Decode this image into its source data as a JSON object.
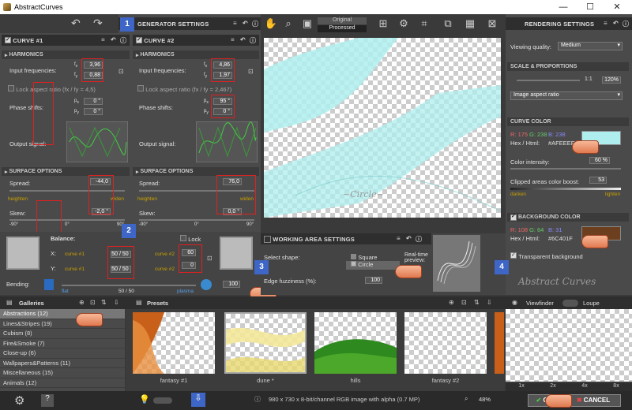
{
  "window": {
    "title": "AbstractCurves",
    "min": "—",
    "max": "☐",
    "close": "✕"
  },
  "generator": {
    "title": "GENERATOR SETTINGS",
    "num": "1"
  },
  "curve1": {
    "title": "CURVE #1",
    "harmonics": "HARMONICS",
    "input_freq": "Input frequencies:",
    "fx": "3,96",
    "fy": "0,88",
    "lock": "Lock aspect ratio (fx / fy = 4,5)",
    "phase": "Phase shifts:",
    "px": "0 °",
    "py": "0 °",
    "output": "Output signal:",
    "surface": "SURFACE OPTIONS",
    "spread_lbl": "Spread:",
    "spread": "-44,0",
    "heighten": "heighten",
    "widen": "widen",
    "skew_lbl": "Skew:",
    "skew": "-2,0 °",
    "m90": "-90°",
    "z0": "0°",
    "p90": "90°"
  },
  "curve2": {
    "title": "CURVE #2",
    "harmonics": "HARMONICS",
    "input_freq": "Input frequencies:",
    "fx": "4,86",
    "fy": "1,97",
    "lock": "Lock aspect ratio (fx / fy = 2,467)",
    "phase": "Phase shifts:",
    "px": "95 °",
    "py": "0 °",
    "output": "Output signal:",
    "surface": "SURFACE OPTIONS",
    "spread_lbl": "Spread:",
    "spread": "76,0",
    "heighten": "heighten",
    "widen": "widen",
    "skew_lbl": "Skew:",
    "skew": "0,0 °",
    "m90": "-90°",
    "z0": "0°",
    "p90": "90°"
  },
  "balance": {
    "label": "Balance:",
    "lock": "Lock",
    "x": "X:",
    "y": "Y:",
    "curve1": "curve #1",
    "curve2": "curve #2",
    "xval": "50 / 50",
    "yval": "50 / 50",
    "cx": "60",
    "cy": "0",
    "num": "2"
  },
  "bending": {
    "label": "Bending:",
    "flat": "flat",
    "plasma": "plasma",
    "val": "50 / 50",
    "fuzz": "100"
  },
  "toolbar": {
    "original": "Original",
    "processed": "Processed"
  },
  "working": {
    "title": "WORKING AREA SETTINGS",
    "shape": "Select shape:",
    "square": "Square",
    "circle": "Circle",
    "fuzz_lbl": "Edge fuzziness (%):",
    "fuzz": "100",
    "preview": "Real-time preview:",
    "num": "3"
  },
  "rendering": {
    "title": "RENDERING SETTINGS",
    "quality_lbl": "Viewing quality:",
    "quality": "Medium",
    "scale": "SCALE & PROPORTIONS",
    "ratio": "1:1",
    "pct": "120%",
    "aspect": "Image aspect ratio",
    "color": "CURVE COLOR",
    "r": "R: 175",
    "g": "G: 238",
    "b": "B: 238",
    "hex_lbl": "Hex / Html:",
    "hex": "#AFEEEE",
    "intensity_lbl": "Color intensity:",
    "intensity": "60 %",
    "clip_lbl": "Clipped areas color boost:",
    "clip": "53",
    "darken": "darken",
    "lighten": "lighten",
    "bg": "BACKGROUND COLOR",
    "br": "R: 108",
    "bgc": "G: 64",
    "bb": "B: 31",
    "bhex": "#6C401F",
    "transparent": "Transparent background",
    "logo": "Abstract Curves",
    "num": "4",
    "curve_color": "#AFEEEE",
    "bg_color": "#6C401F"
  },
  "galleries": {
    "title": "Galleries",
    "items": [
      "Abstractions (12)",
      "Lines&Stripes (19)",
      "Cubism (8)",
      "Fire&Smoke (7)",
      "Close-up (6)",
      "Wallpapers&Patterns (11)",
      "Miscellaneous (15)",
      "Animals (12)"
    ]
  },
  "presets": {
    "title": "Presets",
    "items": [
      "fantasy #1",
      "dune *",
      "hills",
      "fantasy #2"
    ]
  },
  "viewfinder": {
    "title": "Viewfinder",
    "loupe": "Loupe",
    "zooms": [
      "1x",
      "2x",
      "4x",
      "8x"
    ]
  },
  "status": {
    "info": "980 x 730 x 8-bit/channel RGB image with alpha  (0.7 MP)",
    "zoom": "48%"
  },
  "buttons": {
    "ok": "OK",
    "cancel": "CANCEL"
  }
}
